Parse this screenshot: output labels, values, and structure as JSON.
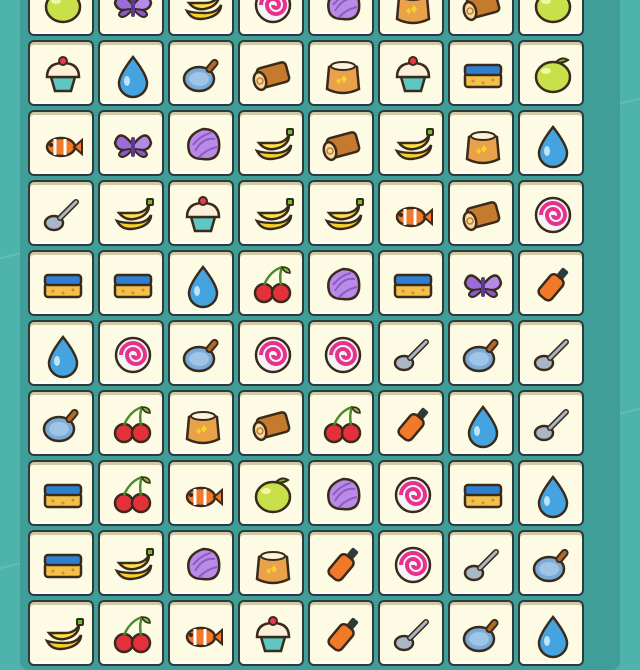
{
  "game": {
    "columns": 8,
    "rows": [
      [
        "lemon",
        "butterfly",
        "banana",
        "candy",
        "shell",
        "flour-sack",
        "log",
        "lemon"
      ],
      [
        "cupcake",
        "water-drop",
        "frying-pan",
        "log",
        "flour-sack",
        "cupcake",
        "sponge",
        "lemon"
      ],
      [
        "clownfish",
        "butterfly",
        "shell",
        "banana",
        "log",
        "banana",
        "flour-sack",
        "water-drop"
      ],
      [
        "spoon",
        "banana",
        "cupcake",
        "banana",
        "banana",
        "clownfish",
        "log",
        "candy"
      ],
      [
        "sponge",
        "sponge",
        "water-drop",
        "cherries",
        "shell",
        "sponge",
        "butterfly",
        "bottle"
      ],
      [
        "water-drop",
        "candy",
        "frying-pan",
        "candy",
        "candy",
        "spoon",
        "frying-pan",
        "spoon"
      ],
      [
        "frying-pan",
        "cherries",
        "flour-sack",
        "log",
        "cherries",
        "bottle",
        "water-drop",
        "spoon"
      ],
      [
        "sponge",
        "cherries",
        "clownfish",
        "lemon",
        "shell",
        "candy",
        "sponge",
        "water-drop"
      ],
      [
        "sponge",
        "banana",
        "shell",
        "flour-sack",
        "bottle",
        "candy",
        "spoon",
        "frying-pan"
      ],
      [
        "banana",
        "cherries",
        "clownfish",
        "cupcake",
        "bottle",
        "spoon",
        "frying-pan",
        "water-drop"
      ]
    ]
  },
  "colors": {
    "background": "#4fb3ad",
    "tile_face": "#fdfbe3",
    "tile_border": "#2f3b3a"
  }
}
